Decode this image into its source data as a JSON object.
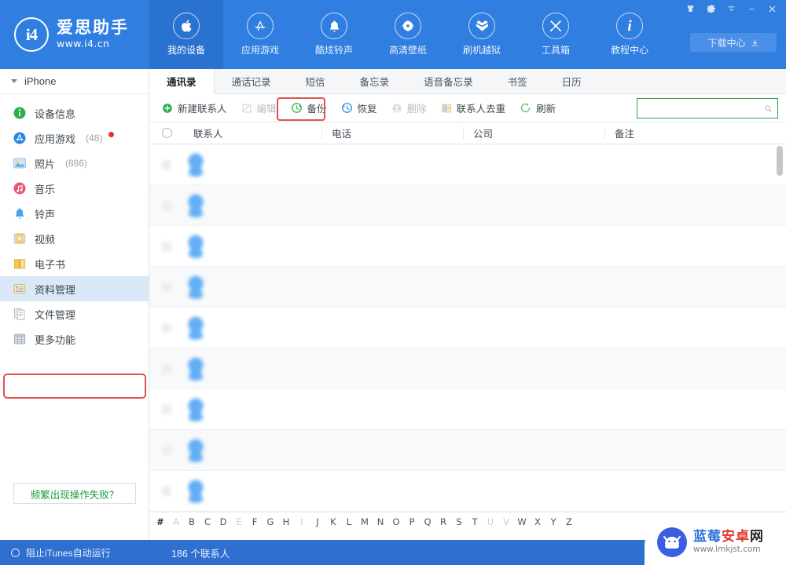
{
  "header": {
    "brand": {
      "name": "爱思助手",
      "url": "www.i4.cn",
      "logo_text": "i4",
      "logo_icon": "i4-circle-logo"
    },
    "nav": [
      {
        "label": "我的设备",
        "icon": "apple-icon",
        "active": true
      },
      {
        "label": "应用游戏",
        "icon": "appstore-icon",
        "active": false
      },
      {
        "label": "酷炫铃声",
        "icon": "bell-icon",
        "active": false
      },
      {
        "label": "高清壁纸",
        "icon": "flower-icon",
        "active": false
      },
      {
        "label": "刷机越狱",
        "icon": "open-box-icon",
        "active": false
      },
      {
        "label": "工具箱",
        "icon": "tools-icon",
        "active": false
      },
      {
        "label": "教程中心",
        "icon": "info-icon",
        "active": false
      }
    ],
    "window_controls": [
      {
        "name": "skin-icon",
        "glyph": "shirt"
      },
      {
        "name": "settings-gear-icon",
        "glyph": "gear"
      },
      {
        "name": "menu-dropdown-icon",
        "glyph": "caret"
      },
      {
        "name": "minimize-icon",
        "glyph": "minus"
      },
      {
        "name": "close-icon",
        "glyph": "cross"
      }
    ],
    "download_center": {
      "label": "下载中心",
      "icon": "download-arrow-icon"
    }
  },
  "sidebar": {
    "device": {
      "label": "iPhone",
      "icon": "chevron-down-icon"
    },
    "items": [
      {
        "label": "设备信息",
        "count": "",
        "icon": "info-badge-icon",
        "selected": false,
        "dot": false
      },
      {
        "label": "应用游戏",
        "count": "(48)",
        "icon": "appstore-badge-icon",
        "selected": false,
        "dot": true
      },
      {
        "label": "照片",
        "count": "(886)",
        "icon": "photo-icon",
        "selected": false,
        "dot": false
      },
      {
        "label": "音乐",
        "count": "",
        "icon": "music-note-icon",
        "selected": false,
        "dot": false
      },
      {
        "label": "铃声",
        "count": "",
        "icon": "bell-icon",
        "selected": false,
        "dot": false
      },
      {
        "label": "视频",
        "count": "",
        "icon": "film-icon",
        "selected": false,
        "dot": false
      },
      {
        "label": "电子书",
        "count": "",
        "icon": "book-icon",
        "selected": false,
        "dot": false
      },
      {
        "label": "资料管理",
        "count": "",
        "icon": "data-list-icon",
        "selected": true,
        "dot": false
      },
      {
        "label": "文件管理",
        "count": "",
        "icon": "file-copy-icon",
        "selected": false,
        "dot": false
      },
      {
        "label": "更多功能",
        "count": "",
        "icon": "grid-icon",
        "selected": false,
        "dot": false
      }
    ],
    "help_button": {
      "label": "频繁出现操作失败？"
    }
  },
  "main": {
    "tabs": [
      {
        "label": "通讯录",
        "active": true
      },
      {
        "label": "通话记录",
        "active": false
      },
      {
        "label": "短信",
        "active": false
      },
      {
        "label": "备忘录",
        "active": false
      },
      {
        "label": "语音备忘录",
        "active": false
      },
      {
        "label": "书签",
        "active": false
      },
      {
        "label": "日历",
        "active": false
      }
    ],
    "toolbar": [
      {
        "label": "新建联系人",
        "icon": "plus-circle-icon",
        "disabled": false,
        "highlighted": false
      },
      {
        "label": "编辑",
        "icon": "pencil-square-icon",
        "disabled": true,
        "highlighted": false
      },
      {
        "label": "备份",
        "icon": "backup-circle-icon",
        "disabled": false,
        "highlighted": true
      },
      {
        "label": "恢复",
        "icon": "restore-circle-icon",
        "disabled": false,
        "highlighted": false
      },
      {
        "label": "删除",
        "icon": "delete-circle-icon",
        "disabled": true,
        "highlighted": false
      },
      {
        "label": "联系人去重",
        "icon": "contact-card-icon",
        "disabled": false,
        "highlighted": false
      },
      {
        "label": "刷新",
        "icon": "refresh-icon",
        "disabled": false,
        "highlighted": false
      }
    ],
    "search": {
      "value": "",
      "placeholder": "",
      "icon": "search-icon"
    },
    "columns": [
      "联系人",
      "电话",
      "公司",
      "备注"
    ],
    "rows": [
      {
        "name": "",
        "phone": "",
        "company": "",
        "note": "",
        "avatar": "contact-avatar"
      },
      {
        "name": "",
        "phone": "",
        "company": "",
        "note": "",
        "avatar": "contact-avatar"
      },
      {
        "name": "",
        "phone": "",
        "company": "",
        "note": "",
        "avatar": "contact-avatar"
      },
      {
        "name": "",
        "phone": "",
        "company": "",
        "note": "",
        "avatar": "contact-avatar"
      },
      {
        "name": "",
        "phone": "",
        "company": "",
        "note": "",
        "avatar": "contact-avatar"
      },
      {
        "name": "",
        "phone": "",
        "company": "",
        "note": "",
        "avatar": "contact-avatar"
      },
      {
        "name": "",
        "phone": "",
        "company": "",
        "note": "",
        "avatar": "contact-avatar"
      },
      {
        "name": "",
        "phone": "",
        "company": "",
        "note": "",
        "avatar": "contact-avatar"
      },
      {
        "name": "",
        "phone": "",
        "company": "",
        "note": "",
        "avatar": "contact-avatar"
      }
    ],
    "alpha_index": [
      {
        "c": "#",
        "on": true
      },
      {
        "c": "A",
        "on": false
      },
      {
        "c": "B",
        "on": true
      },
      {
        "c": "C",
        "on": true
      },
      {
        "c": "D",
        "on": true
      },
      {
        "c": "E",
        "on": false
      },
      {
        "c": "F",
        "on": true
      },
      {
        "c": "G",
        "on": true
      },
      {
        "c": "H",
        "on": true
      },
      {
        "c": "I",
        "on": false
      },
      {
        "c": "J",
        "on": true
      },
      {
        "c": "K",
        "on": true
      },
      {
        "c": "L",
        "on": true
      },
      {
        "c": "M",
        "on": true
      },
      {
        "c": "N",
        "on": true
      },
      {
        "c": "O",
        "on": true
      },
      {
        "c": "P",
        "on": true
      },
      {
        "c": "Q",
        "on": true
      },
      {
        "c": "R",
        "on": true
      },
      {
        "c": "S",
        "on": true
      },
      {
        "c": "T",
        "on": true
      },
      {
        "c": "U",
        "on": false
      },
      {
        "c": "V",
        "on": false
      },
      {
        "c": "W",
        "on": true
      },
      {
        "c": "X",
        "on": true
      },
      {
        "c": "Y",
        "on": true
      },
      {
        "c": "Z",
        "on": true
      }
    ]
  },
  "statusbar": {
    "itunes_toggle": {
      "label": "阻止iTunes自动运行"
    },
    "contact_count": "186 个联系人"
  },
  "watermark": {
    "title_blue": "蓝莓",
    "title_red": "安卓",
    "title_dark": "网",
    "url": "www.lmkjst.com",
    "logo": "android-head-icon"
  },
  "colors": {
    "header_blue": "#2f7ee0",
    "status_blue": "#2f6fd0",
    "highlight_red": "#e2504e",
    "search_border_green": "#2e9c4e",
    "selected_row": "#dbe8f7"
  }
}
